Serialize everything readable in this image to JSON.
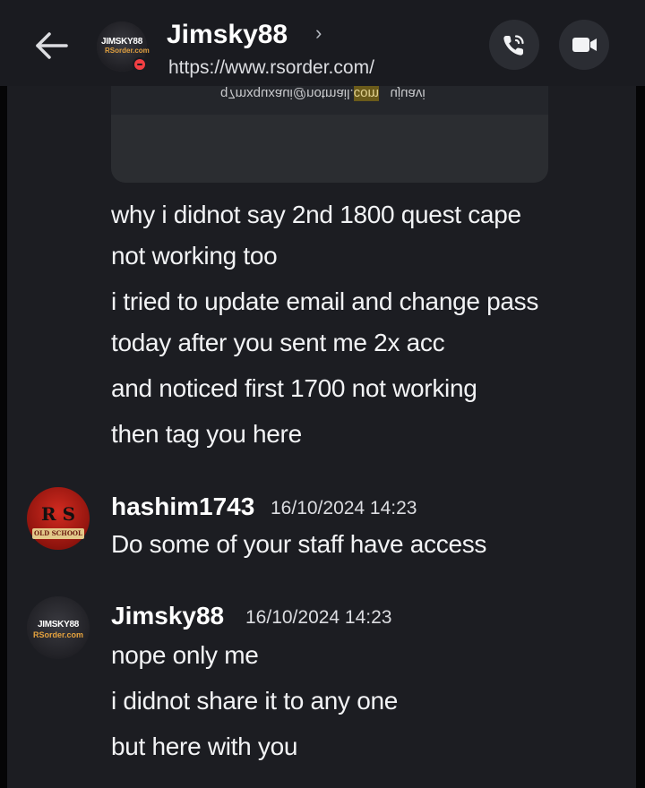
{
  "header": {
    "back_icon": "arrow-left-icon",
    "name": "Jimsky88",
    "chevron": "›",
    "status": "https://www.rsorder.com/",
    "avatar_text_line1": "JIMSKY88",
    "avatar_text_line2": "RSorder.com",
    "call_icon": "phone-call-icon",
    "video_icon": "video-camera-icon"
  },
  "embed": {
    "snippet_left": "q7mxquxaui@notmail.",
    "snippet_highlight": "com",
    "snippet_right": "ujuavi"
  },
  "messages": {
    "continuation": [
      "why i didnot say 2nd 1800 quest cape",
      "not working too",
      "i tried to update email and change pass",
      "today after you sent me 2x acc",
      "and noticed first 1700 not working",
      "then tag you here"
    ],
    "group2": {
      "author": "hashim1743",
      "timestamp": "16/10/2024 14:23",
      "avatar_letters": "R S",
      "avatar_sub": "OLD SCHOOL",
      "lines": [
        "Do some of your staff have access"
      ]
    },
    "group3": {
      "author": "Jimsky88",
      "timestamp": "16/10/2024 14:23",
      "avatar_text_line1": "JIMSKY88",
      "avatar_text_line2": "RSorder.com",
      "lines": [
        "nope only me",
        "i didnot share it to any one",
        "but here with you"
      ]
    }
  },
  "colors": {
    "background": "#1c1d22",
    "text": "#f2f3f5",
    "dnd_status": "#f23f43",
    "embed_bg": "#2b2d31"
  }
}
